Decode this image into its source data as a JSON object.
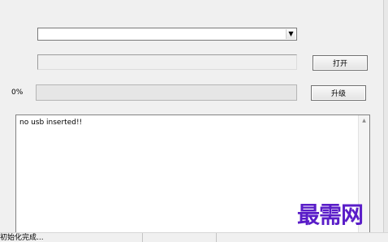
{
  "device_select": {
    "value": "",
    "dropdown_icon": "chevron-down-icon"
  },
  "path_field": {
    "value": ""
  },
  "buttons": {
    "open_label": "打开",
    "upgrade_label": "升级"
  },
  "progress": {
    "label": "0%",
    "value": 0
  },
  "log": {
    "text": "no usb inserted!!"
  },
  "status_bar": {
    "message": "初始化完成..."
  },
  "watermark": {
    "text": "最需网",
    "color": "#5a1dc8"
  }
}
